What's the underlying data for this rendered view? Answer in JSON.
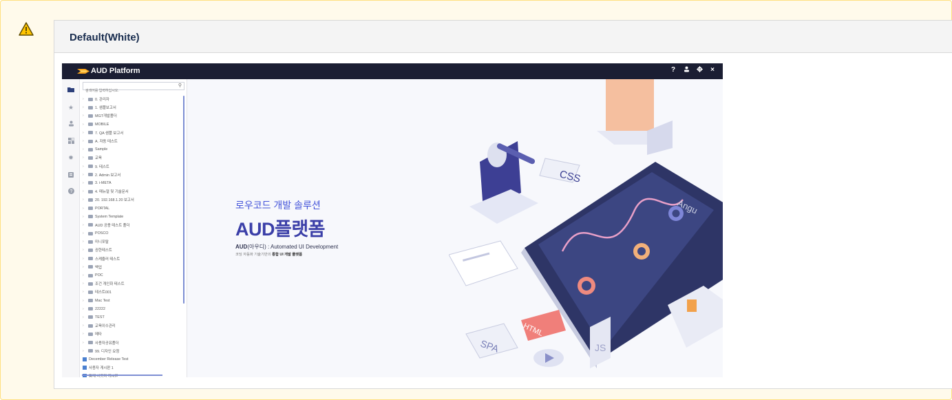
{
  "panel": {
    "warning_icon": "warning-triangle-icon",
    "title": "Default(White)"
  },
  "app": {
    "brand": "AUD Platform",
    "top_icons": {
      "help": "?",
      "user": "user-icon",
      "settings": "gear-icon",
      "close": "×"
    },
    "rail_icons": [
      "folder-icon",
      "star-icon",
      "user-icon",
      "grid-icon",
      "bug-icon",
      "clipboard-icon",
      "help-circle-icon"
    ],
    "search": {
      "placeholder": "검색어를 입력하십시오."
    },
    "tree": [
      {
        "type": "folder",
        "label": "0. 관리자"
      },
      {
        "type": "folder",
        "label": "1. 샘플보고서"
      },
      {
        "type": "folder",
        "label": "MGT개발폴더"
      },
      {
        "type": "folder",
        "label": "MOBILE"
      },
      {
        "type": "folder",
        "label": "7. QA 샘플 보고서"
      },
      {
        "type": "folder",
        "label": "A. 자동 테스트"
      },
      {
        "type": "folder",
        "label": "Sample"
      },
      {
        "type": "folder",
        "label": "교육"
      },
      {
        "type": "folder",
        "label": "9. 테스트"
      },
      {
        "type": "folder",
        "label": "2. Admin 보고서"
      },
      {
        "type": "folder",
        "label": "3. i-META"
      },
      {
        "type": "folder",
        "label": "4. 매뉴얼 및 기술문서"
      },
      {
        "type": "folder",
        "label": "20. 192.168.1.20 보고서"
      },
      {
        "type": "folder",
        "label": "PORTAL"
      },
      {
        "type": "folder",
        "label": "System Template"
      },
      {
        "type": "folder",
        "label": "AUD 공용 테스트 폴더"
      },
      {
        "type": "folder",
        "label": "POSCO"
      },
      {
        "type": "folder",
        "label": "미니포탈"
      },
      {
        "type": "folder",
        "label": "권한테스트"
      },
      {
        "type": "folder",
        "label": "스케쥴러 테스트"
      },
      {
        "type": "folder",
        "label": "백업"
      },
      {
        "type": "folder",
        "label": "POC"
      },
      {
        "type": "folder",
        "label": "조건 개인화 테스트"
      },
      {
        "type": "folder",
        "label": "테스트001"
      },
      {
        "type": "folder",
        "label": "Mac Test"
      },
      {
        "type": "folder",
        "label": "22222"
      },
      {
        "type": "folder",
        "label": "TEST"
      },
      {
        "type": "folder",
        "label": "교육이수관리"
      },
      {
        "type": "folder",
        "label": "메타"
      },
      {
        "type": "folder",
        "label": "사용자공유폴더"
      },
      {
        "type": "folder",
        "label": "99. 디자인 요청"
      },
      {
        "type": "report",
        "label": "December Release Test"
      },
      {
        "type": "report",
        "label": "사용자 게시판 1"
      },
      {
        "type": "report",
        "label": "통계 사용자 게시판"
      }
    ],
    "hero": {
      "subtitle_accent": "로우코드",
      "subtitle_rest": " 개발 솔루션",
      "title": "AUD플랫폼",
      "line1_bold": "AUD",
      "line1_rest": "(아우디) : Automated UI Development",
      "line2_rest": "코딩 자동화 기술기반의 ",
      "line2_bold": "통합 UI 개발 플랫폼",
      "badges": [
        "CSS",
        "HTML",
        "SPA",
        "JS",
        "Angu"
      ]
    }
  }
}
